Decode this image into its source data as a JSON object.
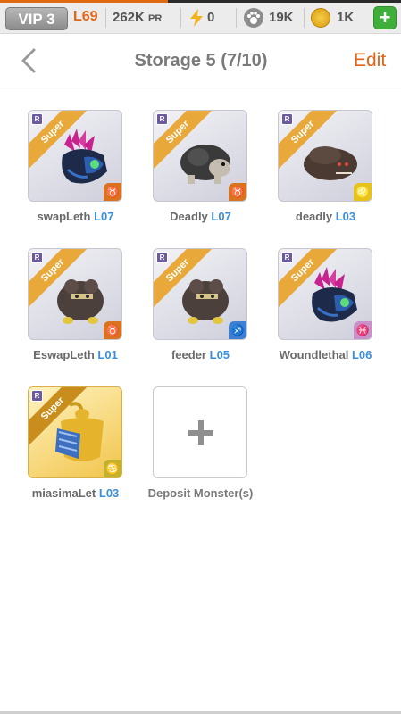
{
  "status_bar": {
    "vip": "VIP 3",
    "level": "L69",
    "power": "262K",
    "power_unit": "PR",
    "energy": "0",
    "food": "19K",
    "gold": "1K",
    "add": "+",
    "colors": {
      "accent": "#e0641a",
      "add_button": "#3fae3a"
    },
    "icons": [
      "lightning-icon",
      "paw-icon",
      "coin-icon",
      "plus-icon"
    ]
  },
  "header": {
    "title": "Storage 5 (7/10)",
    "edit_label": "Edit",
    "back_icon": "chevron-left-icon"
  },
  "monsters": [
    {
      "rarity_badge": "R",
      "tier": "Super",
      "name": "swapLeth",
      "level": "L07",
      "element_icon": "taurus-icon",
      "element_glyph": "♉"
    },
    {
      "rarity_badge": "R",
      "tier": "Super",
      "name": "Deadly",
      "level": "L07",
      "element_icon": "taurus-icon",
      "element_glyph": "♉"
    },
    {
      "rarity_badge": "R",
      "tier": "Super",
      "name": "deadly",
      "level": "L03",
      "element_icon": "leo-icon",
      "element_glyph": "♌"
    },
    {
      "rarity_badge": "R",
      "tier": "Super",
      "name": "EswapLeth",
      "level": "L01",
      "element_icon": "taurus-icon",
      "element_glyph": "♉"
    },
    {
      "rarity_badge": "R",
      "tier": "Super",
      "name": "feeder",
      "level": "L05",
      "element_icon": "sagittarius-icon",
      "element_glyph": "♐"
    },
    {
      "rarity_badge": "R",
      "tier": "Super",
      "name": "Woundlethal",
      "level": "L06",
      "element_icon": "pisces-icon",
      "element_glyph": "♓"
    },
    {
      "rarity_badge": "R",
      "tier": "Super",
      "name": "miasimaLet",
      "level": "L03",
      "element_icon": "cancer-icon",
      "element_glyph": "♋"
    }
  ],
  "deposit": {
    "label": "Deposit Monster(s)",
    "icon": "plus-icon"
  }
}
